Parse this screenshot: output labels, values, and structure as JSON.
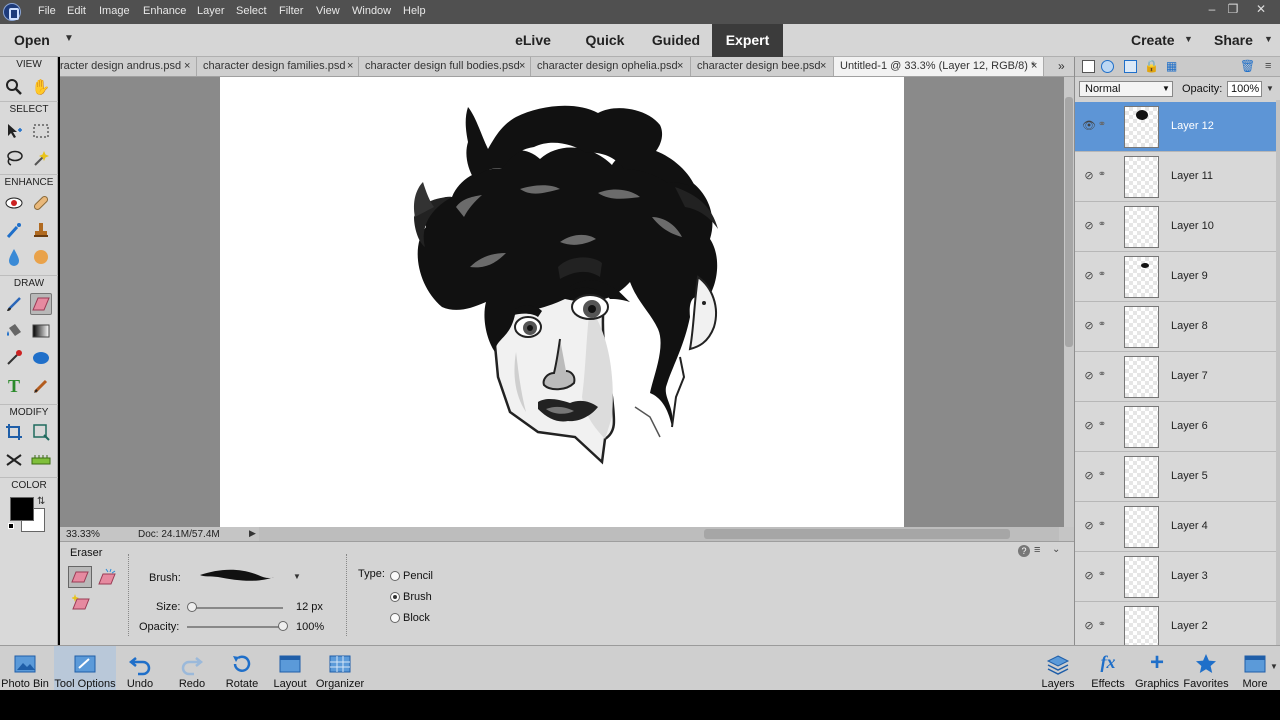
{
  "menubar": {
    "items": [
      "File",
      "Edit",
      "Image",
      "Enhance",
      "Layer",
      "Select",
      "Filter",
      "View",
      "Window",
      "Help"
    ]
  },
  "modebar": {
    "open_label": "Open",
    "modes": [
      "eLive",
      "Quick",
      "Guided",
      "Expert"
    ],
    "active_mode": "Expert",
    "create_label": "Create",
    "share_label": "Share"
  },
  "toolbox": {
    "sections": [
      "VIEW",
      "SELECT",
      "ENHANCE",
      "DRAW",
      "MODIFY",
      "COLOR"
    ],
    "foreground_color": "#000000",
    "background_color": "#ffffff"
  },
  "tabs": [
    "racter design andrus.psd",
    "character design families.psd",
    "character design full bodies.psd",
    "character design ophelia.psd",
    "character design bee.psd",
    "Untitled-1 @ 33.3% (Layer 12, RGB/8) *"
  ],
  "statusbar": {
    "zoom": "33.33%",
    "doc_info": "Doc: 24.1M/57.4M"
  },
  "tool_options": {
    "tool_name": "Eraser",
    "brush_label": "Brush:",
    "size_label": "Size:",
    "size_value": "12 px",
    "size_fraction": 0.02,
    "opacity_label": "Opacity:",
    "opacity_value": "100%",
    "opacity_fraction": 1.0,
    "type_label": "Type:",
    "types": [
      "Pencil",
      "Brush",
      "Block"
    ],
    "selected_type": "Brush"
  },
  "layers_panel": {
    "blend_mode": "Normal",
    "opacity_label": "Opacity:",
    "opacity_value": "100%",
    "layers": [
      "Layer 12",
      "Layer 11",
      "Layer 10",
      "Layer 9",
      "Layer 8",
      "Layer 7",
      "Layer 6",
      "Layer 5",
      "Layer 4",
      "Layer 3",
      "Layer 2"
    ],
    "selected_layer": "Layer 12"
  },
  "bottombar": {
    "left": [
      "Photo Bin",
      "Tool Options",
      "Undo",
      "Redo",
      "Rotate",
      "Layout",
      "Organizer"
    ],
    "right": [
      "Layers",
      "Effects",
      "Graphics",
      "Favorites",
      "More"
    ]
  },
  "colors": {
    "accent_selected": "#5d95d6",
    "active_mode_bg": "#3b3b3b"
  }
}
